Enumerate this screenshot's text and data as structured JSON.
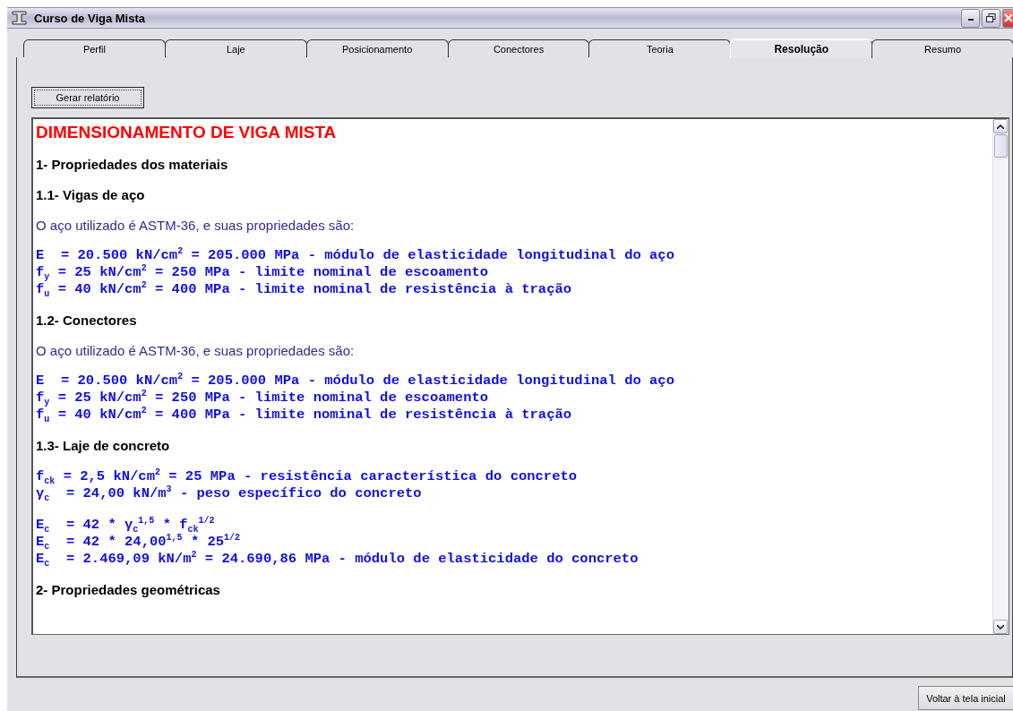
{
  "window": {
    "title": "Curso de Viga Mista"
  },
  "tabs": [
    {
      "label": "Perfil",
      "selected": false
    },
    {
      "label": "Laje",
      "selected": false
    },
    {
      "label": "Posicionamento",
      "selected": false
    },
    {
      "label": "Conectores",
      "selected": false
    },
    {
      "label": "Teoria",
      "selected": false
    },
    {
      "label": "Resolução",
      "selected": true
    },
    {
      "label": "Resumo",
      "selected": false
    }
  ],
  "report_button": "Gerar relatório",
  "report": [
    {
      "kind": "title",
      "text": "DIMENSIONAMENTO DE VIGA MISTA"
    },
    {
      "kind": "heading",
      "text": "1- Propriedades dos materiais"
    },
    {
      "kind": "heading",
      "text": "1.1- Vigas de aço"
    },
    {
      "kind": "note",
      "text": "O aço utilizado é ASTM-36, e suas propriedades são:"
    },
    {
      "kind": "formula",
      "lines": [
        "E  = 20.500 kN/cm$^{2}$ = 205.000 MPa - módulo de elasticidade longitudinal do aço",
        "f$_{y}$ = 25 kN/cm$^{2}$ = 250 MPa - limite nominal de escoamento",
        "f$_{u}$ = 40 kN/cm$^{2}$ = 400 MPa - limite nominal de resistência à tração"
      ]
    },
    {
      "kind": "heading",
      "text": "1.2- Conectores"
    },
    {
      "kind": "note",
      "text": "O aço utilizado é ASTM-36, e suas propriedades são:"
    },
    {
      "kind": "formula",
      "lines": [
        "E  = 20.500 kN/cm$^{2}$ = 205.000 MPa - módulo de elasticidade longitudinal do aço",
        "f$_{y}$ = 25 kN/cm$^{2}$ = 250 MPa - limite nominal de escoamento",
        "f$_{u}$ = 40 kN/cm$^{2}$ = 400 MPa - limite nominal de resistência à tração"
      ]
    },
    {
      "kind": "heading",
      "text": "1.3- Laje de concreto"
    },
    {
      "kind": "formula",
      "lines": [
        "f$_{ck}$ = 2,5 kN/cm$^{2}$ = 25 MPa - resistência característica do concreto",
        "γ$_{c}$  = 24,00 kN/m$^{3}$ - peso específico do concreto"
      ]
    },
    {
      "kind": "formula",
      "lines": [
        "E$_{c}$  = 42 * γ$_{c}$$^{1,5}$ * f$_{ck}$$^{1/2}$",
        "E$_{c}$  = 42 * 24,00$^{1,5}$ * 25$^{1/2}$",
        "E$_{c}$  = 2.469,09 kN/m$^{2}$ = 24.690,86 MPa - módulo de elasticidade do concreto"
      ]
    },
    {
      "kind": "heading",
      "text": "2- Propriedades geométricas"
    }
  ],
  "back_button": "Voltar à tela inicial"
}
